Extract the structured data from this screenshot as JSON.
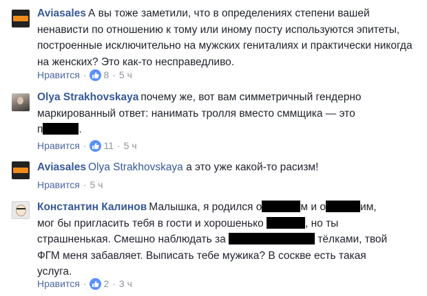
{
  "comments": [
    {
      "author": "Aviasales",
      "text": "А вы тоже заметили, что в определениях степени вашей ненависти по отношению к тому или иному посту используются эпитеты, построенные исключительно на мужских гениталиях и практически никогда на женских? Это как-то несправедливо.",
      "like_label": "Нравится",
      "like_count": "8",
      "time": "5 ч"
    },
    {
      "author": "Olya Strakhovskaya",
      "text_line1": "почему же, вот вам симметричный гендерно",
      "text_line2": "маркированный ответ: нанимать тролля вместо сммщика — это",
      "text_line3_start": "п",
      "text_line3_end": ".",
      "like_label": "Нравится",
      "like_count": "11",
      "time": "5 ч"
    },
    {
      "author": "Aviasales",
      "mention": "Olya Strakhovskaya",
      "text": "а это уже какой-то расизм!",
      "like_label": "Нравится",
      "time": "5 ч"
    },
    {
      "author": "Константин Калинов",
      "t1": "Малышка, я родился о",
      "t2": "м и о",
      "t3": "им,",
      "t4": "мог бы пригласить тебя в гости и хорошенько",
      "t5": ", но ты",
      "t6": "страшненькая. Смешно наблюдать за",
      "t7": "тёлками, твой",
      "t8": "ФГМ меня забавляет. Выписать тебе мужика? В соскве есть такая",
      "t9": "услуга.",
      "like_label": "Нравится",
      "like_count": "2",
      "time": "3 ч"
    }
  ],
  "colors": {
    "link": "#365899",
    "meta": "#90949c",
    "like_blue": "#5890ff"
  },
  "icons": {
    "like": "thumbs-up-icon"
  }
}
